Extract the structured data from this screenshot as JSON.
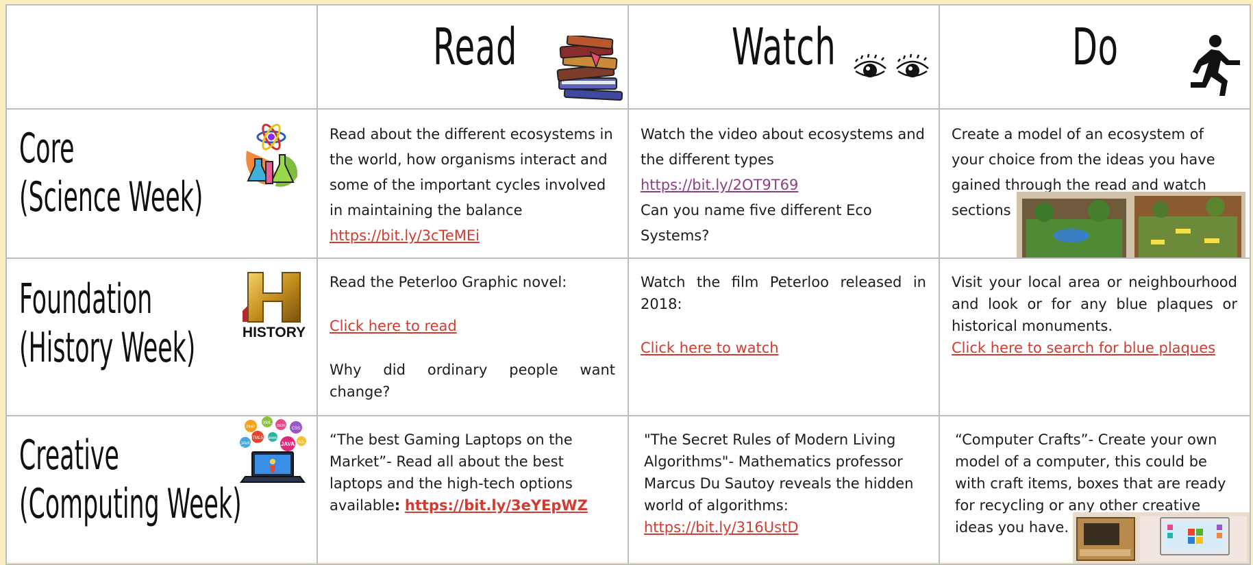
{
  "headers": {
    "read": "Read",
    "watch": "Watch",
    "do": "Do"
  },
  "rows": [
    {
      "title_line1": "Core",
      "title_line2": "(Science Week)",
      "icon": "science-lab-icon",
      "read": {
        "text": "Read about the different ecosystems in the world, how organisms interact and some of the important cycles involved in maintaining the balance",
        "link": "https://bit.ly/3cTeMEi"
      },
      "watch": {
        "text": "Watch the video about ecosystems and the different types",
        "link": "https://bit.ly/2OT9T69",
        "question": "Can you name five different Eco Systems?"
      },
      "do": {
        "text": "Create a model of an ecosystem of your choice from the ideas you have gained through the read and watch sections"
      }
    },
    {
      "title_line1": "Foundation",
      "title_line2": "(History Week)",
      "icon_text": "HISTORY",
      "read": {
        "text": "Read the Peterloo Graphic novel:",
        "link": "Click here to read",
        "question_a": "Why did ordinary people want",
        "question_b": "change?"
      },
      "watch": {
        "text": "Watch the film Peterloo released in 2018:",
        "link": "Click here to watch"
      },
      "do": {
        "text": "Visit your local area or neighbourhood and  look or for any blue plaques or historical monuments.",
        "link": "Click here to search for blue plaques"
      }
    },
    {
      "title_line1": "Creative",
      "title_line2": "(Computing Week)",
      "icon": "coding-laptop-icon",
      "read": {
        "text": "“The best Gaming Laptops on the Market”- Read all about the best laptops and the high-tech options available",
        "colon": ":",
        "link": "https://bit.ly/3eYEpWZ"
      },
      "watch": {
        "text": "\"The Secret Rules of Modern Living Algorithms\"- Mathematics professor Marcus Du Sautoy reveals the hidden world of algorithms:",
        "link": "https://bit.ly/316UstD"
      },
      "do": {
        "text": "“Computer Crafts”- Create your own model of a computer, this could be with craft items, boxes that are ready for recycling or any other creative ideas you have."
      }
    }
  ],
  "bubble_labels": [
    "HTML5",
    "JAVA",
    "JAVA",
    "CSS",
    "PHP",
    "XML",
    "JSON",
    "SQL",
    "www",
    "RUBY",
    "C++"
  ],
  "colors": {
    "link": "#d23b2f",
    "visited_link": "#8c3f86",
    "background": "#fbeebf",
    "border": "#bdbdbd"
  }
}
